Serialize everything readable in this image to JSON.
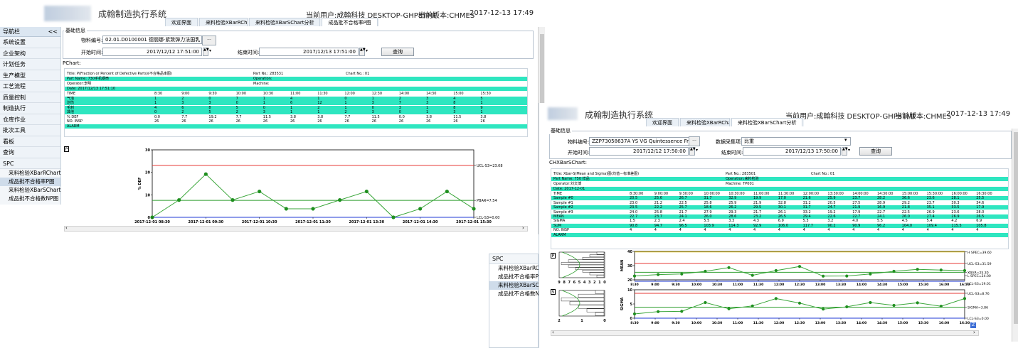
{
  "left": {
    "app_title": "成翰制造执行系统",
    "user_info": "当前用户:成翰科技 DESKTOP-GHP8TMF",
    "version_info": "当前版本:CHMES",
    "datetime": "2017-12-13 17:49",
    "tabs": [
      "欢迎界面",
      "来料检验XBarRChar",
      "来料检验XBarSChart分析",
      "成品批不合格率P图"
    ],
    "nav": {
      "header": "导航栏",
      "collapse": "<<",
      "items": [
        "系统设置",
        "企业架构",
        "计划任务",
        "生产模型",
        "工艺流程",
        "质量控制",
        "制造执行",
        "仓库作业",
        "批次工具",
        "看板",
        "查询"
      ],
      "group": "SPC",
      "sub_items": [
        "来料检验XBarRChart",
        "成品批不合格率P图",
        "来料检验XBarSChart分",
        "成品批不合格数NP图"
      ]
    },
    "form": {
      "legend": "基础信息",
      "material_label": "物料编号:",
      "material_value": "02.01.D0100001 德丽娜·紧致弹力法国乳 量小(...",
      "start_label": "开始时间:",
      "start_value": "2017/12/12 17:51:00",
      "end_label": "结束时间:",
      "end_value": "2017/12/13 17:51:00",
      "query_button": "查询"
    },
    "chart_caption": "PChart:",
    "report": {
      "title": "Title: P(Fraction or Percent of Defective Parts)(不合格品率图)",
      "part_no": "Part No.: 283531",
      "chart_no": "Chart No.: 01",
      "part_name": "Part Name: 730手机钢壳",
      "operation": "Operation:",
      "operator": "Operator:李明",
      "machine": "Machine:",
      "date": "Date: 2017/12/13 17:51:10",
      "time_label": "TIME",
      "times": [
        "8:30",
        "9:00",
        "9:30",
        "10:00",
        "10:30",
        "11:00",
        "11:30",
        "12:00",
        "12:30",
        "14:00",
        "14:30",
        "15:00",
        "15:30"
      ],
      "rows": [
        {
          "label": "气泡",
          "values": [
            "1",
            "2",
            "0",
            "7",
            "1",
            "4",
            "1",
            "0",
            "1",
            "2",
            "3",
            "4",
            "5"
          ]
        },
        {
          "label": "划伤",
          "values": [
            "1",
            "3",
            "3",
            "0",
            "1",
            "6",
            "12",
            "1",
            "3",
            "7",
            "3",
            "8",
            "1"
          ]
        },
        {
          "label": "毛刺",
          "values": [
            "4",
            "6",
            "8",
            "5",
            "0",
            "1",
            "2",
            "1",
            "0",
            "3",
            "1",
            "8",
            "9"
          ]
        },
        {
          "label": "其他",
          "values": [
            "0",
            "2",
            "5",
            "2",
            "3",
            "1",
            "1",
            "2",
            "3",
            "0",
            "1",
            "3",
            "1"
          ]
        }
      ],
      "def_label": "% DEF",
      "def_values": [
        "0.0",
        "7.7",
        "19.2",
        "7.7",
        "11.5",
        "3.8",
        "3.8",
        "7.7",
        "11.5",
        "0.0",
        "3.8",
        "11.5",
        "3.8"
      ],
      "insp_label": "NO. INSP",
      "insp_values": [
        "26",
        "26",
        "26",
        "26",
        "26",
        "26",
        "26",
        "26",
        "26",
        "26",
        "26",
        "26",
        "26"
      ],
      "alarm_label": "ALARM"
    },
    "p_box": "P"
  },
  "chart_data": [
    {
      "type": "line",
      "title": "",
      "ylabel": "% DEF",
      "x": [
        "2017-12-01 08:30",
        "2017-12-01 09:00",
        "2017-12-01 09:30",
        "2017-12-01 10:00",
        "2017-12-01 10:30",
        "2017-12-01 11:00",
        "2017-12-01 11:30",
        "2017-12-01 12:00",
        "2017-12-01 12:30",
        "2017-12-01 14:00",
        "2017-12-01 14:30",
        "2017-12-01 15:00",
        "2017-12-01 15:30"
      ],
      "x_tick_labels": [
        "2017-12-01 08:30",
        "2017-12-01 09:30",
        "2017-12-01 10:30",
        "2017-12-01 11:30",
        "2017-12-01 13:30",
        "2017-12-01 14:30",
        "2017-12-01 15:30"
      ],
      "series": [
        {
          "values": [
            0.0,
            7.7,
            19.2,
            7.7,
            11.5,
            3.8,
            3.8,
            7.7,
            11.5,
            0.0,
            3.8,
            11.5,
            3.8
          ]
        }
      ],
      "ylim": [
        0,
        30
      ],
      "y_ticks": [
        0,
        10,
        20,
        30
      ],
      "limits": {
        "ucl": 23.08,
        "center": 7.54,
        "lcl": 0.0
      },
      "limit_labels": [
        "UCL-S3=23.08",
        "PBAR=7.54",
        "LCL-S3=0.00"
      ],
      "colors": {
        "ucl": "#e53935",
        "center": "#2e9e2e",
        "lcl": "#1f3ad6",
        "series": "#3aa63a"
      }
    },
    {
      "type": "line",
      "title": "",
      "ylabel": "MEAN",
      "x": [
        "8:30",
        "9:00",
        "9:30",
        "10:00",
        "10:30",
        "11:00",
        "11:30",
        "12:00",
        "13:30",
        "14:00",
        "14:30",
        "15:00",
        "15:30",
        "16:00",
        "16:30"
      ],
      "x_tick_labels": [
        "8:30",
        "9:00",
        "9:30",
        "10:00",
        "10:30",
        "11:00",
        "11:30",
        "12:00",
        "12:30",
        "13:00",
        "13:30",
        "14:00",
        "14:30",
        "15:00",
        "15:30",
        "16:00",
        "16:30"
      ],
      "series": [
        {
          "values": [
            22.7,
            23.7,
            24.1,
            26.0,
            28.6,
            23.2,
            26.5,
            29.4,
            22.6,
            22.7,
            24.1,
            26.0,
            27.4,
            26.9,
            26.5
          ]
        }
      ],
      "ylim": [
        20,
        40
      ],
      "y_ticks": [
        20,
        30,
        40
      ],
      "limits": {
        "hspec": 39.6,
        "ucl": 31.59,
        "center": 25.3,
        "lcl": 19.01
      },
      "limit_labels": [
        "H SPEC=39.60",
        "UCL-S3=31.59",
        "XBAR=25.30",
        "L SPEC=24.00",
        "LCL-S3=19.01"
      ],
      "colors": {
        "hspec": "#e6c619",
        "ucl": "#e53935",
        "center": "#2e9e2e",
        "lcl": "#1f3ad6",
        "series": "#3aa63a"
      }
    },
    {
      "type": "line",
      "title": "",
      "ylabel": "SIGMA",
      "x": [
        "8:30",
        "9:00",
        "9:30",
        "10:00",
        "10:30",
        "11:00",
        "11:30",
        "12:00",
        "13:30",
        "14:00",
        "14:30",
        "15:00",
        "15:30",
        "16:00",
        "16:30"
      ],
      "x_tick_labels": [
        "8:30",
        "9:00",
        "9:30",
        "10:00",
        "10:30",
        "11:00",
        "11:30",
        "12:00",
        "12:30",
        "13:00",
        "13:30",
        "14:00",
        "14:30",
        "15:00",
        "15:30",
        "16:00",
        "16:30"
      ],
      "series": [
        {
          "values": [
            1.5,
            2.3,
            2.4,
            5.5,
            3.3,
            4.3,
            6.9,
            5.3,
            3.2,
            4.0,
            5.5,
            4.5,
            5.4,
            4.2,
            6.9
          ]
        }
      ],
      "ylim": [
        0,
        10
      ],
      "y_ticks": [
        0,
        5,
        10
      ],
      "limits": {
        "ucl": 8.76,
        "center": 3.86,
        "lcl": 0.0
      },
      "limit_labels": [
        "UCL-S3=8.76",
        "SIGMA=3.86",
        "LCL-S3=0.00"
      ],
      "colors": {
        "ucl": "#e53935",
        "center": "#2e9e2e",
        "lcl": "#1f3ad6",
        "series": "#3aa63a"
      }
    }
  ],
  "right": {
    "app_title": "成翰制造执行系统",
    "user_info": "当前用户:成翰科技 DESKTOP-GHP8TMF",
    "version_info": "当前版本:CHMES",
    "datetime": "2017-12-13 17:49",
    "tabs": [
      "欢迎界面",
      "来料检验XBarRCha",
      "来料检验XBarSChart分析"
    ],
    "form": {
      "legend": "基础信息",
      "material_label": "物料编号:",
      "material_value": "ZZP73058637A YS VG Quintessence Fresh M...",
      "item_label": "数据采集项:",
      "item_value": "比重",
      "start_label": "开始时间:",
      "start_value": "2017/12/12 17:50:00",
      "end_label": "结束时间:",
      "end_value": "2017/12/13 17:50:00",
      "query_button": "查询"
    },
    "chart_caption": "CHXBarSChart:",
    "report": {
      "title": "Title: Xbar-S(Mean and Sigma)图(均值－标准差图)",
      "part_no": "Part No.: 283501",
      "chart_no": "Chart No.: 01",
      "part_name": "Part Name: 750 样品",
      "operation": "Operation:来料检验",
      "operator": "Operator:刘文博",
      "machine": "Machine: TP001",
      "date": "Date: 2017-12-01",
      "time_label": "TIME",
      "times": [
        "8:30:00",
        "9:00:00",
        "9:30:00",
        "10:00:00",
        "10:30:00",
        "11:00:00",
        "11:30:00",
        "12:00:00",
        "13:30:00",
        "14:00:00",
        "14:30:00",
        "15:00:00",
        "15:30:00",
        "16:00:00",
        "16:30:00"
      ],
      "rows": [
        {
          "label": "Sample #0",
          "values": [
            "20.5",
            "25.6",
            "26.7",
            "31.7",
            "32.9",
            "19.9",
            "17.0",
            "21.6",
            "25.9",
            "23.7",
            "28.2",
            "36.6",
            "23.6",
            "28.1",
            "25.5"
          ]
        },
        {
          "label": "Sample #1",
          "values": [
            "23.0",
            "21.2",
            "22.5",
            "25.8",
            "25.9",
            "21.9",
            "32.8",
            "31.2",
            "20.5",
            "27.5",
            "28.9",
            "29.2",
            "23.7",
            "30.3",
            "34.6"
          ]
        },
        {
          "label": "Sample #2",
          "values": [
            "23.5",
            "22.2",
            "25.7",
            "18.6",
            "26.2",
            "29.5",
            "30.1",
            "31.7",
            "24.7",
            "21.9",
            "16.9",
            "21.8",
            "35.1",
            "33.5",
            "17.9"
          ]
        },
        {
          "label": "Sample #3",
          "values": [
            "24.0",
            "25.8",
            "21.7",
            "27.9",
            "29.3",
            "21.7",
            "26.1",
            "33.2",
            "19.2",
            "17.9",
            "22.7",
            "22.5",
            "26.9",
            "23.6",
            "28.0"
          ]
        },
        {
          "label": "MEAN",
          "values": [
            "22.7",
            "23.7",
            "24.1",
            "26.0",
            "28.6",
            "23.2",
            "26.5",
            "29.4",
            "22.6",
            "22.7",
            "24.1",
            "26.0",
            "27.4",
            "26.9",
            "26.5"
          ]
        },
        {
          "label": "SIGMA",
          "values": [
            "1.5",
            "2.3",
            "2.4",
            "5.5",
            "3.3",
            "4.3",
            "6.9",
            "5.3",
            "3.2",
            "4.0",
            "5.5",
            "4.5",
            "5.4",
            "4.2",
            "6.9"
          ]
        },
        {
          "label": "SUM",
          "values": [
            "90.8",
            "94.7",
            "96.5",
            "103.9",
            "114.3",
            "92.9",
            "106.0",
            "117.7",
            "90.2",
            "90.9",
            "96.2",
            "104.0",
            "109.4",
            "115.5",
            "105.8"
          ]
        },
        {
          "label": "NO. INSP",
          "values": [
            "4",
            "4",
            "4",
            "4",
            "4",
            "4",
            "4",
            "4",
            "4",
            "4",
            "4",
            "4",
            "4",
            "4",
            "4"
          ]
        }
      ],
      "alarm_label": "ALARM"
    },
    "p_box": "P",
    "s_box": "S",
    "hist_x_labels": [
      "9",
      "8",
      "7",
      "6",
      "5",
      "4",
      "3",
      "2",
      "1",
      "0"
    ],
    "hist2_x_labels": [
      "2",
      "1",
      "0"
    ]
  },
  "spc_panel": {
    "group": "SPC",
    "sub_items": [
      "来料检验XBarRChart",
      "成品批不合格率P图",
      "来料检验XBarSChart分",
      "成品批不合格数NP图"
    ]
  }
}
